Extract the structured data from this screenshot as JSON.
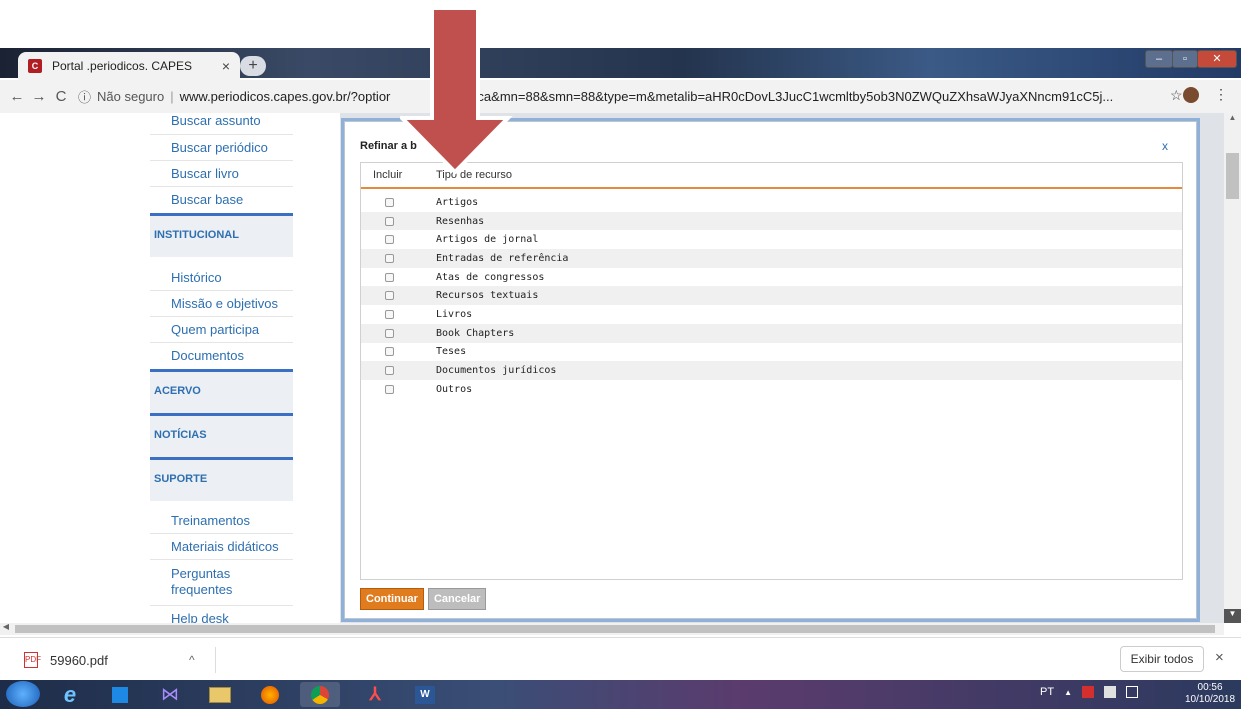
{
  "browser": {
    "tab_title": "Portal .periodicos. CAPES",
    "tab_close": "×",
    "new_tab": "+",
    "security_label": "Não seguro",
    "url_left": "www.periodicos.capes.gov.br/?optior",
    "url_right": "etabusca&mn=88&smn=88&type=m&metalib=aHR0cDovL3JucC1wcmltby5ob3N0ZWQuZXhsaWJyaXNncm91cC5j...",
    "back": "←",
    "forward": "→",
    "reload": "C",
    "info": "ⓘ",
    "separator": "|",
    "star": "☆",
    "menu": "⋮",
    "win_min": "–",
    "win_max": "▫",
    "win_close": "✕"
  },
  "sidebar": {
    "items": [
      {
        "label": "Buscar assunto"
      },
      {
        "label": "Buscar periódico"
      },
      {
        "label": "Buscar livro"
      },
      {
        "label": "Buscar base"
      }
    ],
    "section_institucional": "INSTITUCIONAL",
    "institucional_items": [
      {
        "label": "Histórico"
      },
      {
        "label": "Missão e objetivos"
      },
      {
        "label": "Quem participa"
      },
      {
        "label": "Documentos"
      }
    ],
    "section_acervo": "ACERVO",
    "section_noticias": "NOTÍCIAS",
    "section_suporte": "SUPORTE",
    "suporte_items": [
      {
        "label": "Treinamentos"
      },
      {
        "label": "Materiais didáticos"
      },
      {
        "label": "Perguntas frequentes"
      },
      {
        "label": "Help desk"
      }
    ]
  },
  "modal": {
    "title": "Refinar a b",
    "close": "x",
    "col_include": "Incluir",
    "col_type": "Tipo de recurso",
    "options": [
      {
        "label": "Artigos"
      },
      {
        "label": "Resenhas"
      },
      {
        "label": "Artigos de jornal"
      },
      {
        "label": "Entradas de referência"
      },
      {
        "label": "Atas de congressos"
      },
      {
        "label": "Recursos textuais"
      },
      {
        "label": "Livros"
      },
      {
        "label": "Book Chapters"
      },
      {
        "label": "Teses"
      },
      {
        "label": "Documentos jurídicos"
      },
      {
        "label": "Outros"
      }
    ],
    "continue_label": "Continuar",
    "cancel_label": "Cancelar"
  },
  "downloads": {
    "file_name": "59960.pdf",
    "caret": "^",
    "show_all": "Exibir todos",
    "close": "×"
  },
  "taskbar": {
    "language": "PT",
    "tray_up": "▲",
    "time": "00:56",
    "date": "10/10/2018"
  },
  "colors": {
    "link": "#2d6fb0",
    "accent_orange": "#e07b1e",
    "section_border": "#3a6fc4",
    "arrow": "#c0504d"
  }
}
